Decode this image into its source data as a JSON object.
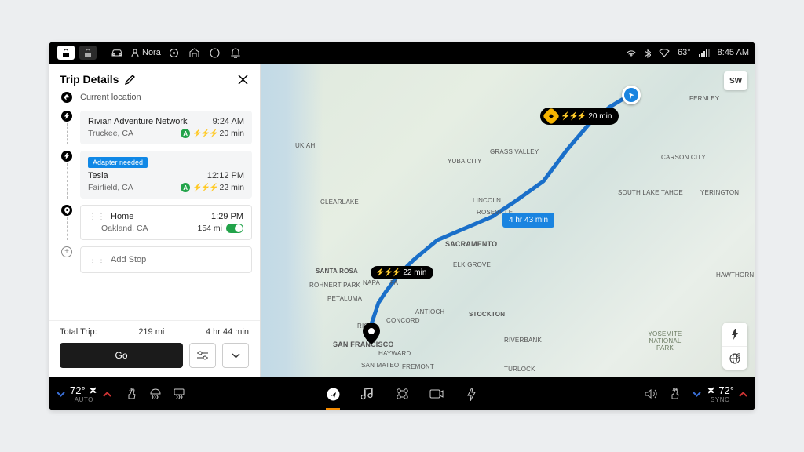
{
  "topbar": {
    "user": "Nora",
    "temp": "63°",
    "time": "8:45 AM"
  },
  "panel": {
    "title": "Trip Details",
    "current_location": "Current location",
    "stop1": {
      "name": "Rivian Adventure Network",
      "location": "Truckee, CA",
      "arrival": "9:24 AM",
      "charge_label": "A",
      "duration": "20 min"
    },
    "stop2": {
      "adapter": "Adapter needed",
      "name": "Tesla",
      "location": "Fairfield, CA",
      "arrival": "12:12 PM",
      "charge_label": "A",
      "duration": "22 min"
    },
    "stop3": {
      "name": "Home",
      "location": "Oakland, CA",
      "arrival": "1:29 PM",
      "distance": "154 mi"
    },
    "add_stop": "Add Stop",
    "summary": {
      "label": "Total Trip:",
      "distance": "219 mi",
      "duration": "4 hr 44 min",
      "go": "Go"
    }
  },
  "map": {
    "compass": "SW",
    "charge_badge1": "20 min",
    "charge_badge2": "22 min",
    "eta": "4 hr 43 min",
    "labels": {
      "sacramento": "SACRAMENTO",
      "sanfrancisco": "SAN FRANCISCO",
      "santarosa": "SANTA ROSA",
      "fremont": "FREMONT",
      "sanmateo": "SAN MATEO",
      "stockton": "STOCKTON",
      "elkgrove": "ELK GROVE",
      "yubacity": "YUBA CITY",
      "hayward": "HAYWARD",
      "lincoln": "LINCOLN",
      "antioch": "ANTIOCH",
      "concord": "CONCORD",
      "rich": "RICH",
      "riverbank": "RIVERBANK",
      "turlock": "TURLOCK",
      "carsoncity": "CARSON CITY",
      "southlake": "SOUTH LAKE TAHOE",
      "grassvalley": "GRASS VALLEY",
      "roseville": "ROSEVILLE",
      "napa": "NAPA",
      "petaluma": "PETALUMA",
      "fairfield": "FA",
      "ukiah": "UKIAH",
      "fernley": "FERNLEY",
      "yerington": "YERINGTON",
      "hawthorne": "HAWTHORNE",
      "clearlake": "CLEARLAKE",
      "rohnertpark": "ROHNERT PARK",
      "yosemite": "YOSEMITE NATIONAL PARK"
    }
  },
  "dock": {
    "left_temp": "72°",
    "left_mode": "AUTO",
    "right_temp": "72°",
    "right_mode": "SYNC"
  }
}
